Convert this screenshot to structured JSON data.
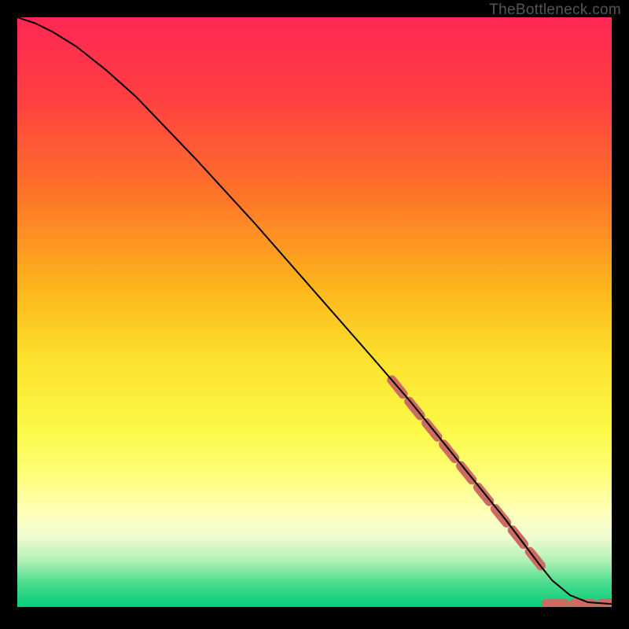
{
  "watermark_text": "TheBottleneck.com",
  "chart_data": {
    "type": "line",
    "title": "",
    "xlabel": "",
    "ylabel": "",
    "xlim": [
      0,
      100
    ],
    "ylim": [
      0,
      100
    ],
    "gradient_stops": [
      {
        "offset": 0,
        "color": "#ff2754"
      },
      {
        "offset": 14,
        "color": "#ff4042"
      },
      {
        "offset": 30,
        "color": "#fe7428"
      },
      {
        "offset": 46,
        "color": "#fdb61c"
      },
      {
        "offset": 58,
        "color": "#fce12d"
      },
      {
        "offset": 70,
        "color": "#fcf947"
      },
      {
        "offset": 78,
        "color": "#feff7d"
      },
      {
        "offset": 84,
        "color": "#ffffbb"
      },
      {
        "offset": 88,
        "color": "#f0fcd2"
      },
      {
        "offset": 92,
        "color": "#b4f1b6"
      },
      {
        "offset": 96,
        "color": "#4adb8d"
      },
      {
        "offset": 100,
        "color": "#05ce7c"
      }
    ],
    "series": [
      {
        "name": "curve",
        "x": [
          0,
          3,
          6,
          10,
          15,
          20,
          30,
          40,
          50,
          60,
          66,
          70,
          74,
          78,
          82,
          85,
          88,
          90,
          93,
          96,
          100
        ],
        "y": [
          100,
          99,
          97.5,
          95,
          91,
          86.5,
          76,
          65,
          53.5,
          42,
          35,
          30,
          25,
          20,
          15,
          11,
          7,
          4.5,
          2,
          0.8,
          0.5
        ]
      }
    ],
    "dashed_segments": [
      {
        "x1": 63,
        "y1": 38.5,
        "x2": 88.5,
        "y2": 6.5
      },
      {
        "x1": 89,
        "y1": 0.6,
        "x2": 100,
        "y2": 0.6
      }
    ],
    "dash_color": "#cb6b62",
    "dash_width": 12,
    "dash_pattern": "23 12"
  }
}
